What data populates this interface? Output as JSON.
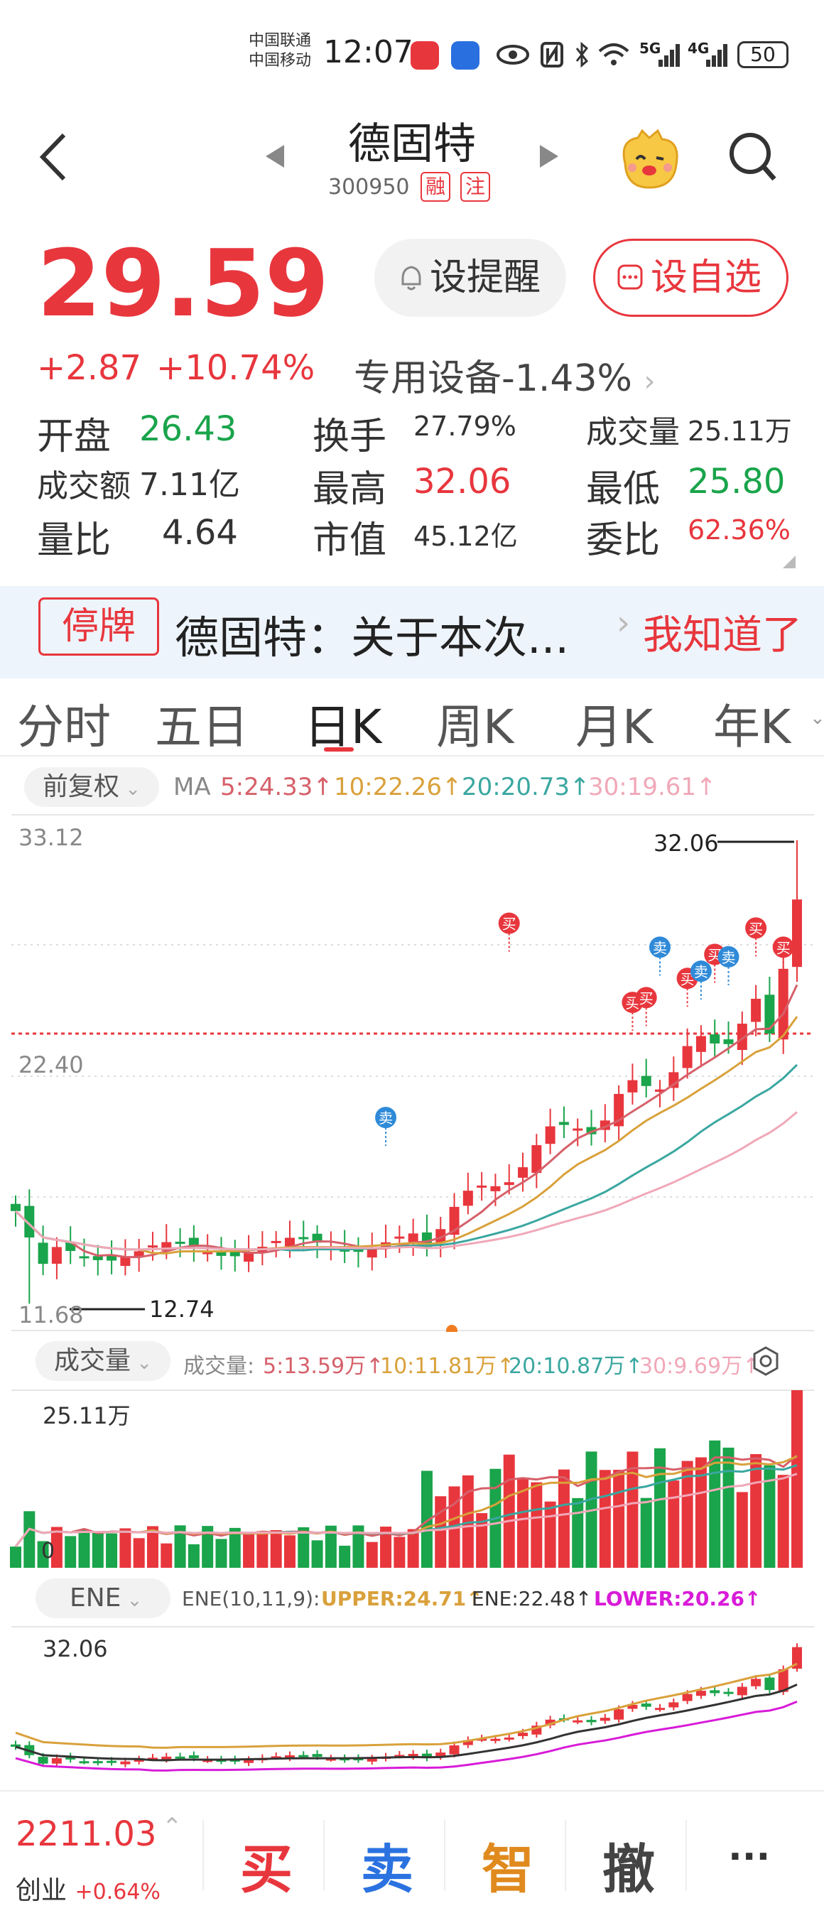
{
  "status_bar": {
    "carrier1": "中国联通",
    "carrier2": "中国移动",
    "time": "12:07",
    "net1": "5G",
    "net2": "4G",
    "battery": "50"
  },
  "header": {
    "title": "德固特",
    "code": "300950",
    "tag_margin": "融",
    "tag_note": "注"
  },
  "quote": {
    "price": "29.59",
    "change": "+2.87",
    "change_pct": "+10.74%",
    "sector": "专用设备",
    "sector_pct": "-1.43%",
    "remind_label": "设提醒",
    "fav_label": "设自选",
    "stats": {
      "open_label": "开盘",
      "open": "26.43",
      "turnover_label": "换手",
      "turnover": "27.79%",
      "volume_label": "成交量",
      "volume": "25.11万",
      "amount_label": "成交额",
      "amount": "7.11亿",
      "high_label": "最高",
      "high": "32.06",
      "low_label": "最低",
      "low": "25.80",
      "ratio_label": "量比",
      "ratio": "4.64",
      "mcap_label": "市值",
      "mcap": "45.12亿",
      "commit_label": "委比",
      "commit": "62.36%"
    }
  },
  "notice": {
    "tag": "停牌",
    "text": "德固特：关于本次...",
    "ok": "我知道了"
  },
  "tabs": [
    "分时",
    "五日",
    "日K",
    "周K",
    "月K",
    "年K"
  ],
  "kline": {
    "adjust": "前复权",
    "ma_label": "MA",
    "ma5": "5:24.33↑",
    "ma10": "10:22.26↑",
    "ma20": "20:20.73↑",
    "ma30": "30:19.61↑",
    "y_top": "33.12",
    "y_mid": "22.40",
    "y_bot": "11.68",
    "high_mark": "32.06",
    "low_mark": "12.74",
    "buy": "买",
    "sell": "卖"
  },
  "volume": {
    "selector": "成交量",
    "label": "成交量:",
    "ma5": "5:13.59万↑",
    "ma10": "10:11.81万↑",
    "ma20": "20:10.87万↑",
    "ma30": "30:9.69万↑",
    "max": "25.11万",
    "zero": "0"
  },
  "ene": {
    "selector": "ENE",
    "params": "ENE(10,11,9):",
    "upper": "UPPER:24.71↑",
    "mid": "ENE:22.48↑",
    "lower": "LOWER:20.26↑",
    "max": "32.06"
  },
  "bottom": {
    "index_value": "2211.03",
    "index_name": "创业",
    "index_pct": "+0.64%",
    "buy": "买",
    "sell": "卖",
    "smart": "智",
    "cancel": "撤",
    "more": "···"
  },
  "colors": {
    "up": "#e8363d",
    "down": "#1aa44b",
    "ma5": "#d6606a",
    "ma10": "#d9a13b",
    "ma20": "#3aa7a0",
    "ma30": "#f0a8b8",
    "upper": "#d9a13b",
    "lower": "#d81bd8"
  },
  "icons": [
    "back-arrow-icon",
    "prev-stock-icon",
    "next-stock-icon",
    "mascot-icon",
    "search-icon",
    "bell-icon",
    "add-fav-icon",
    "settings-icon"
  ]
}
